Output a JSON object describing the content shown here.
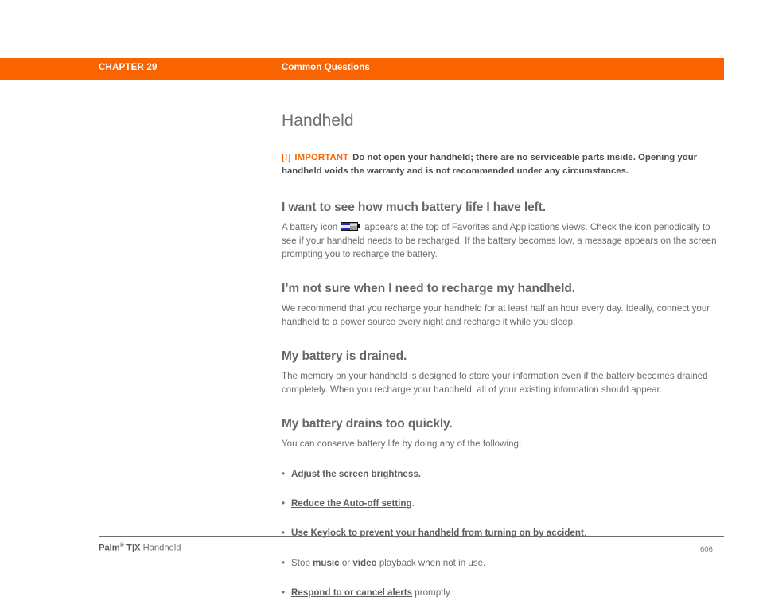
{
  "header": {
    "chapter": "CHAPTER 29",
    "section": "Common Questions",
    "background_color": "#fa6400",
    "text_color": "#ffffff"
  },
  "page": {
    "title": "Handheld"
  },
  "important_note": {
    "bracket_open": "[",
    "bang": "!",
    "bracket_close": "]",
    "label": "IMPORTANT",
    "text": "Do not open your handheld; there are no serviceable parts inside. Opening your handheld voids the warranty and is not recommended under any circumstances.",
    "accent_color": "#fa6400"
  },
  "sections": [
    {
      "heading": "I want to see how much battery life I have left.",
      "body_before_icon": "A battery icon",
      "icon_name": "battery-icon",
      "body_after_icon": "appears at the top of Favorites and Applications views. Check the icon periodically to see if your handheld needs to be recharged. If the battery becomes low, a message appears on the screen prompting you to recharge the battery."
    },
    {
      "heading": "I’m not sure when I need to recharge my handheld.",
      "body": "We recommend that you recharge your handheld for at least half an hour every day. Ideally, connect your handheld to a power source every night and recharge it while you sleep."
    },
    {
      "heading": "My battery is drained.",
      "body": "The memory on your handheld is designed to store your information even if the battery becomes drained completely. When you recharge your handheld, all of your existing information should appear."
    },
    {
      "heading": "My battery drains too quickly.",
      "body": "You can conserve battery life by doing any of the following:"
    }
  ],
  "bullets": [
    {
      "link_text": "Adjust the screen brightness.",
      "trailing_text": ""
    },
    {
      "link_text": "Reduce the Auto-off setting",
      "trailing_text": "."
    },
    {
      "link_text": "Use Keylock to prevent your handheld from turning on by accident",
      "trailing_text": "."
    },
    {
      "leading_text": "Stop ",
      "link_text": "music",
      "middle_text": " or ",
      "link_text_2": "video",
      "trailing_text": " playback when not in use."
    },
    {
      "link_text": "Respond to or cancel alerts",
      "trailing_text": " promptly."
    }
  ],
  "footer": {
    "brand": "Palm",
    "registered": "®",
    "model": "T|X",
    "product": "Handheld",
    "page_number": "606"
  }
}
